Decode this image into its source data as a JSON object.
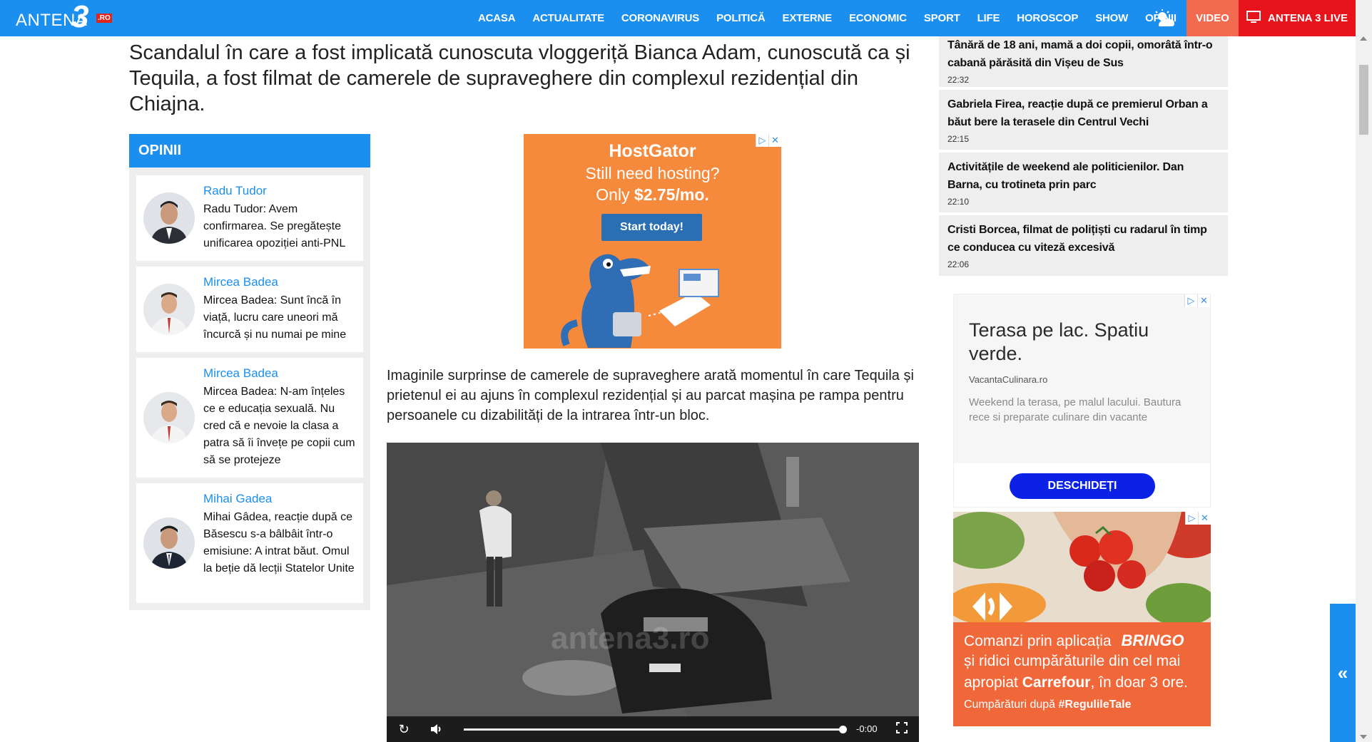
{
  "header": {
    "logo_text": "ANTENA",
    "logo_digit": "3",
    "logo_suffix": ".RO",
    "menu": [
      "ACASA",
      "ACTUALITATE",
      "CORONAVIRUS",
      "POLITICĂ",
      "EXTERNE",
      "ECONOMIC",
      "SPORT",
      "LIFE",
      "HOROSCOP",
      "SHOW",
      "OPINII"
    ],
    "weather_icon": "weather-sun-cloud-icon",
    "video_label": "VIDEO",
    "live_label": "ANTENA 3 LIVE",
    "live_icon": "tv-icon"
  },
  "article": {
    "title": "Scandalul în care a fost implicată cunoscuta vloggeriță Bianca Adam, cunoscută ca și Tequila, a fost filmat de camerele de supraveghere din complexul rezidențial din Chiajna.",
    "paragraph": "Imaginile surprinse de camerele de supraveghere arată momentul în care Tequila și prietenul ei au ajuns în complexul rezidențial și au parcat mașina pe rampa pentru persoanele cu dizabilități de la intrarea într-un bloc.",
    "video": {
      "watermark": "antena3.ro",
      "time": "-0:00",
      "progress": 1.0
    }
  },
  "opinii": {
    "heading": "OPINII",
    "items": [
      {
        "author": "Radu Tudor",
        "text": "Radu Tudor: Avem confirmarea. Se pregătește unificarea opoziției anti-PNL"
      },
      {
        "author": "Mircea Badea",
        "text": "Mircea Badea: Sunt încă în viață, lucru care uneori mă încurcă și nu numai pe mine"
      },
      {
        "author": "Mircea Badea",
        "text": "Mircea Badea: N-am înțeles ce e educația sexuală. Nu cred că e nevoie la clasa a patra să îi învețe pe copii cum să se protejeze"
      },
      {
        "author": "Mihai Gadea",
        "text": "Mihai Gâdea, reacție după ce Băsescu s-a bâlbâit într-o emisiune: A intrat băut. Omul la beție dă lecții Statelor Unite"
      }
    ]
  },
  "news": [
    {
      "title": "Tânără de 18 ani, mamă a doi copii, omorâtă într-o cabană părăsită din Vișeu de Sus",
      "time": "22:32"
    },
    {
      "title": "Gabriela Firea, reacție după ce premierul Orban a băut bere la terasele din Centrul Vechi",
      "time": "22:15"
    },
    {
      "title": "Activitățile de weekend ale politicienilor. Dan Barna, cu trotineta prin parc",
      "time": "22:10"
    },
    {
      "title": "Cristi Borcea, filmat de polițiști cu radarul în timp ce conducea cu viteză excesivă",
      "time": "22:06"
    }
  ],
  "ads": {
    "hostgator": {
      "brand": "HostGator",
      "line1": "Still need hosting?",
      "line2_prefix": "Only ",
      "line2_price": "$2.75/mo.",
      "cta": "Start today!"
    },
    "terasa": {
      "title": "Terasa pe lac. Spatiu verde.",
      "url": "VacantaCulinara.ro",
      "desc": "Weekend la terasa, pe malul lacului. Bautura rece si preparate culinare din vacante",
      "cta": "DESCHIDEȚI"
    },
    "carrefour": {
      "line1_prefix": "Comanzi prin aplicația",
      "line1_brand": "BRINGO",
      "line2": "și ridici cumpărăturile din cel mai",
      "line3_prefix": "apropiat ",
      "line3_brand": "Carrefour",
      "line3_suffix": ", în doar 3 ore.",
      "footer_prefix": "Cumpărături după ",
      "footer_tag": "#RegulileTale"
    }
  },
  "side_tab": {
    "label": "«"
  },
  "colors": {
    "brand_blue": "#1a8ff0",
    "live_red": "#e8141b",
    "video_orange": "#f26b50"
  }
}
